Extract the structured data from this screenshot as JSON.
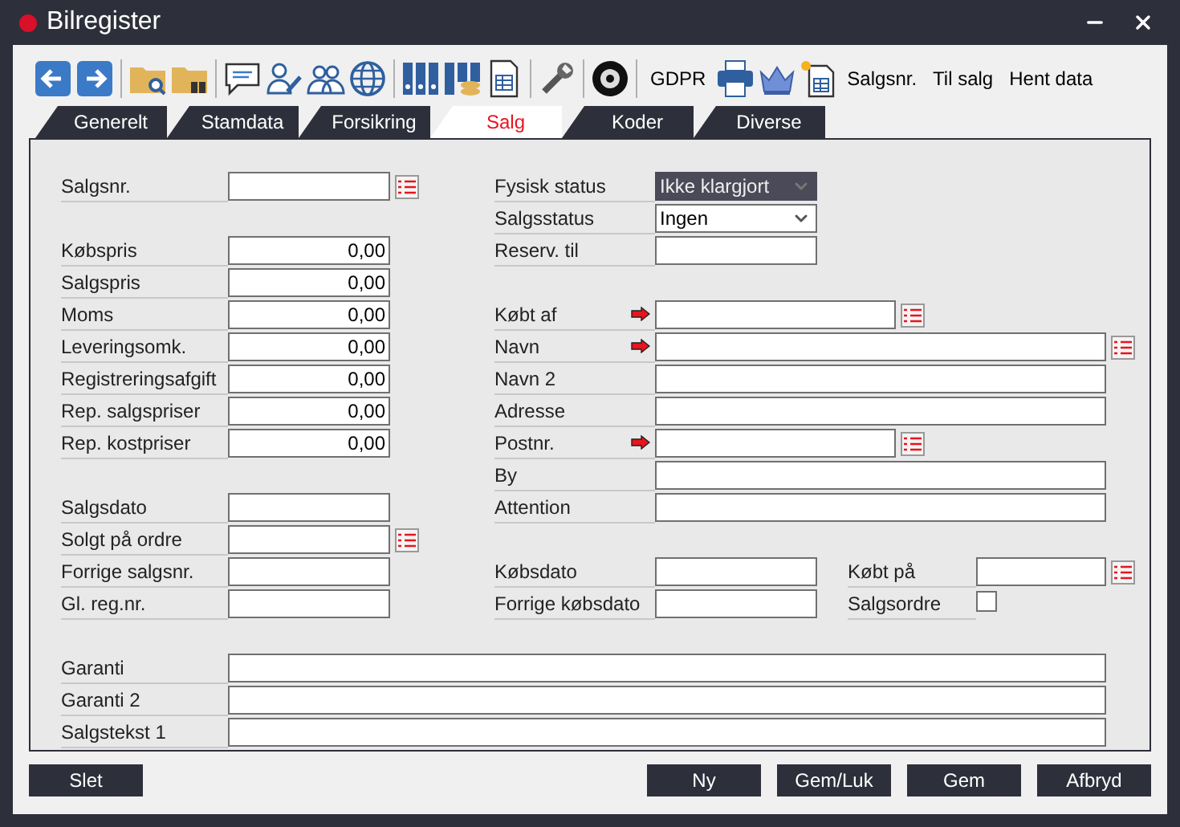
{
  "window": {
    "title": "Bilregister"
  },
  "toolbar": {
    "text_buttons": [
      "GDPR",
      "Salgsnr.",
      "Til salg",
      "Hent data"
    ]
  },
  "tabs": [
    {
      "label": "Generelt",
      "selected": false
    },
    {
      "label": "Stamdata",
      "selected": false
    },
    {
      "label": "Forsikring",
      "selected": false
    },
    {
      "label": "Salg",
      "selected": true
    },
    {
      "label": "Koder",
      "selected": false
    },
    {
      "label": "Diverse",
      "selected": false
    }
  ],
  "form": {
    "upper_left": [
      [
        {
          "label": "Salgsnr.",
          "kind": "text",
          "lookup": true,
          "required": false
        }
      ],
      [
        {
          "label": "Købspris",
          "kind": "number",
          "value": "0,00",
          "lookup": false,
          "required": false
        },
        {
          "label": "Salgspris",
          "kind": "number",
          "value": "0,00",
          "lookup": false,
          "required": false
        },
        {
          "label": "Moms",
          "kind": "number",
          "value": "0,00",
          "lookup": false,
          "required": false
        },
        {
          "label": "Leveringsomk.",
          "kind": "number",
          "value": "0,00",
          "lookup": false,
          "required": false
        },
        {
          "label": "Registreringsafgift",
          "kind": "number",
          "value": "0,00",
          "lookup": false,
          "required": false
        },
        {
          "label": "Rep. salgspriser",
          "kind": "number",
          "value": "0,00",
          "lookup": false,
          "required": false
        },
        {
          "label": "Rep. kostpriser",
          "kind": "number",
          "value": "0,00",
          "lookup": false,
          "required": false
        }
      ],
      [
        {
          "label": "Salgsdato",
          "kind": "text",
          "lookup": false,
          "required": false
        },
        {
          "label": "Solgt på ordre",
          "kind": "text",
          "lookup": true,
          "required": false
        }
      ]
    ],
    "upper_right": [
      [
        {
          "label": "Fysisk status",
          "kind": "select",
          "value": "Ikke klargjort",
          "disabled": true,
          "lookup": false,
          "required": false
        },
        {
          "label": "Salgsstatus",
          "kind": "select",
          "value": "Ingen",
          "disabled": false,
          "lookup": false,
          "required": false
        },
        {
          "label": "Reserv. til",
          "kind": "text",
          "lookup": false,
          "required": false
        }
      ],
      [
        {
          "label": "Købt af",
          "kind": "text",
          "lookup": true,
          "required": true
        },
        {
          "label": "Navn",
          "kind": "text",
          "lookup": true,
          "required": true
        },
        {
          "label": "Navn 2",
          "kind": "text",
          "lookup": false,
          "required": false
        },
        {
          "label": "Adresse",
          "kind": "text",
          "lookup": false,
          "required": false
        },
        {
          "label": "Postnr.",
          "kind": "text",
          "lookup": true,
          "required": true
        },
        {
          "label": "By",
          "kind": "text",
          "lookup": false,
          "required": false
        },
        {
          "label": "Attention",
          "kind": "text",
          "lookup": false,
          "required": false
        }
      ]
    ],
    "middle": [
      [
        {
          "label": "Forrige salgsnr.",
          "kind": "text",
          "lookup": false,
          "required": false
        },
        {
          "label": "Gl. reg.nr.",
          "kind": "text",
          "lookup": false,
          "required": false
        }
      ],
      [
        {
          "label": "Købsdato",
          "kind": "text",
          "lookup": false,
          "required": false
        },
        {
          "label": "Forrige købsdato",
          "kind": "text",
          "lookup": false,
          "required": false
        }
      ],
      [
        {
          "label": "Købt på",
          "kind": "text",
          "lookup": true,
          "required": false
        },
        {
          "label": "Salgsordre",
          "kind": "checkbox",
          "checked": false,
          "lookup": false,
          "required": false
        }
      ]
    ],
    "lower": [
      {
        "label": "Garanti",
        "kind": "text",
        "lookup": false,
        "required": false
      },
      {
        "label": "Garanti 2",
        "kind": "text",
        "lookup": false,
        "required": false
      },
      {
        "label": "Salgstekst 1",
        "kind": "text",
        "lookup": false,
        "required": false
      }
    ]
  },
  "buttons_left": [
    "Slet"
  ],
  "buttons_right": [
    "Ny",
    "Gem/Luk",
    "Gem",
    "Afbryd"
  ]
}
